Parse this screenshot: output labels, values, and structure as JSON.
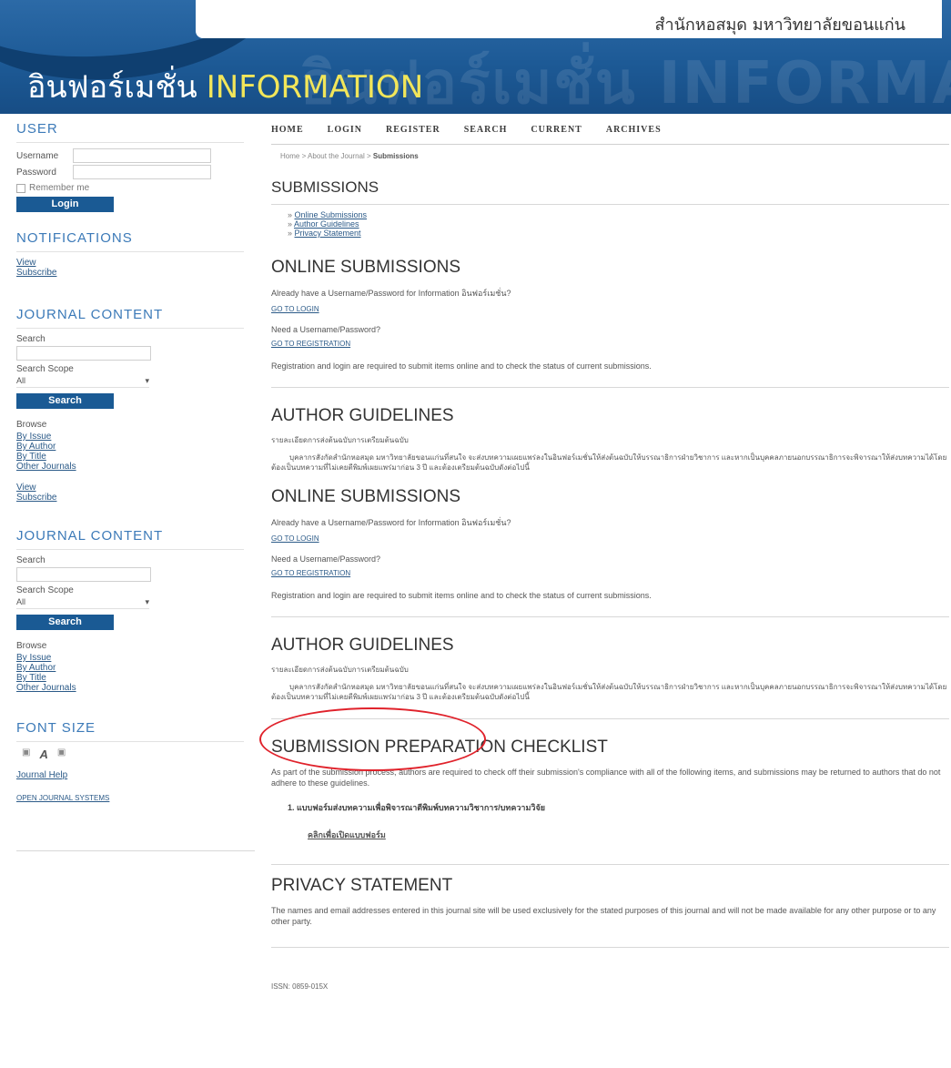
{
  "header": {
    "university": "สำนักหอสมุด มหาวิทยาลัยขอนแก่น",
    "logo_thai": "อินฟอร์เมชั่น",
    "logo_en": "INFORMATION",
    "ghost_text": "อินฟอร์เมชั่น INFORMATION"
  },
  "sidebar": {
    "user": {
      "title": "USER",
      "username_label": "Username",
      "password_label": "Password",
      "remember_label": "Remember me",
      "login_button": "Login"
    },
    "notifications": {
      "title": "NOTIFICATIONS",
      "links": [
        "View",
        "Subscribe"
      ]
    },
    "journal_content": {
      "title": "JOURNAL CONTENT",
      "search_label": "Search",
      "scope_label": "Search Scope",
      "scope_value": "All",
      "search_button": "Search",
      "browse_label": "Browse",
      "browse_links": [
        "By Issue",
        "By Author",
        "By Title",
        "Other Journals"
      ],
      "extra_links": [
        "View",
        "Subscribe"
      ]
    },
    "journal_content_2": {
      "title": "JOURNAL CONTENT",
      "search_label": "Search",
      "scope_label": "Search Scope",
      "scope_value": "All",
      "search_button": "Search",
      "browse_label": "Browse",
      "browse_links": [
        "By Issue",
        "By Author",
        "By Title",
        "Other Journals"
      ]
    },
    "font_size": {
      "title": "FONT SIZE",
      "journal_help": "Journal Help",
      "ojs": "OPEN JOURNAL SYSTEMS"
    }
  },
  "nav": [
    "HOME",
    "LOGIN",
    "REGISTER",
    "SEARCH",
    "CURRENT",
    "ARCHIVES"
  ],
  "breadcrumb": {
    "home": "Home",
    "about": "About the Journal",
    "current": "Submissions"
  },
  "main": {
    "submissions_title": "SUBMISSIONS",
    "toc": [
      "Online Submissions",
      "Author Guidelines",
      "Privacy Statement"
    ],
    "online_title": "ONLINE SUBMISSIONS",
    "have_account": "Already have a Username/Password for Information อินฟอร์เมชั่น?",
    "go_login": "GO TO LOGIN",
    "need_account": "Need a Username/Password?",
    "go_register": "GO TO REGISTRATION",
    "registration_note": "Registration and login are required to submit items online and to check the status of current submissions.",
    "author_title": "AUTHOR GUIDELINES",
    "author_sub": "รายละเอียดการส่งต้นฉบับการเตรียมต้นฉบับ",
    "author_para": "บุคลากรสังกัดสำนักหอสมุด มหาวิทยาลัยขอนแก่นที่สนใจ จะส่งบทความเผยแพร่ลงในอินฟอร์เมชั่นให้ส่งต้นฉบับให้บรรณาธิการฝ่ายวิชาการ และหากเป็นบุคคลภายนอกบรรณาธิการจะพิจารณาให้ส่งบทความได้โดยต้องเป็นบทความที่ไม่เคยตีพิมพ์เผยแพร่มาก่อน 3 ปี และต้องเตรียมต้นฉบับดังต่อไปนี้",
    "checklist_title": "SUBMISSION PREPARATION CHECKLIST",
    "checklist_intro": "As part of the submission process, authors are required to check off their submission's compliance with all of the following items, and submissions may be returned to authors that do not adhere to these guidelines.",
    "checklist_item": "1. แบบฟอร์มส่งบทความเพื่อพิจารณาตีพิมพ์บทความวิชาการ/บทความวิจัย",
    "checklist_link": "คลิกเพื่อเปิดแบบฟอร์ม",
    "privacy_title": "PRIVACY STATEMENT",
    "privacy_text": "The names and email addresses entered in this journal site will be used exclusively for the stated purposes of this journal and will not be made available for any other purpose or to any other party.",
    "isbn": "ISSN: 0859-015X"
  },
  "colors": {
    "header_blue": "#1d5a96",
    "button_blue": "#1a5a94",
    "heading_blue": "#3c7ab8",
    "annotation_red": "#e0222b"
  }
}
